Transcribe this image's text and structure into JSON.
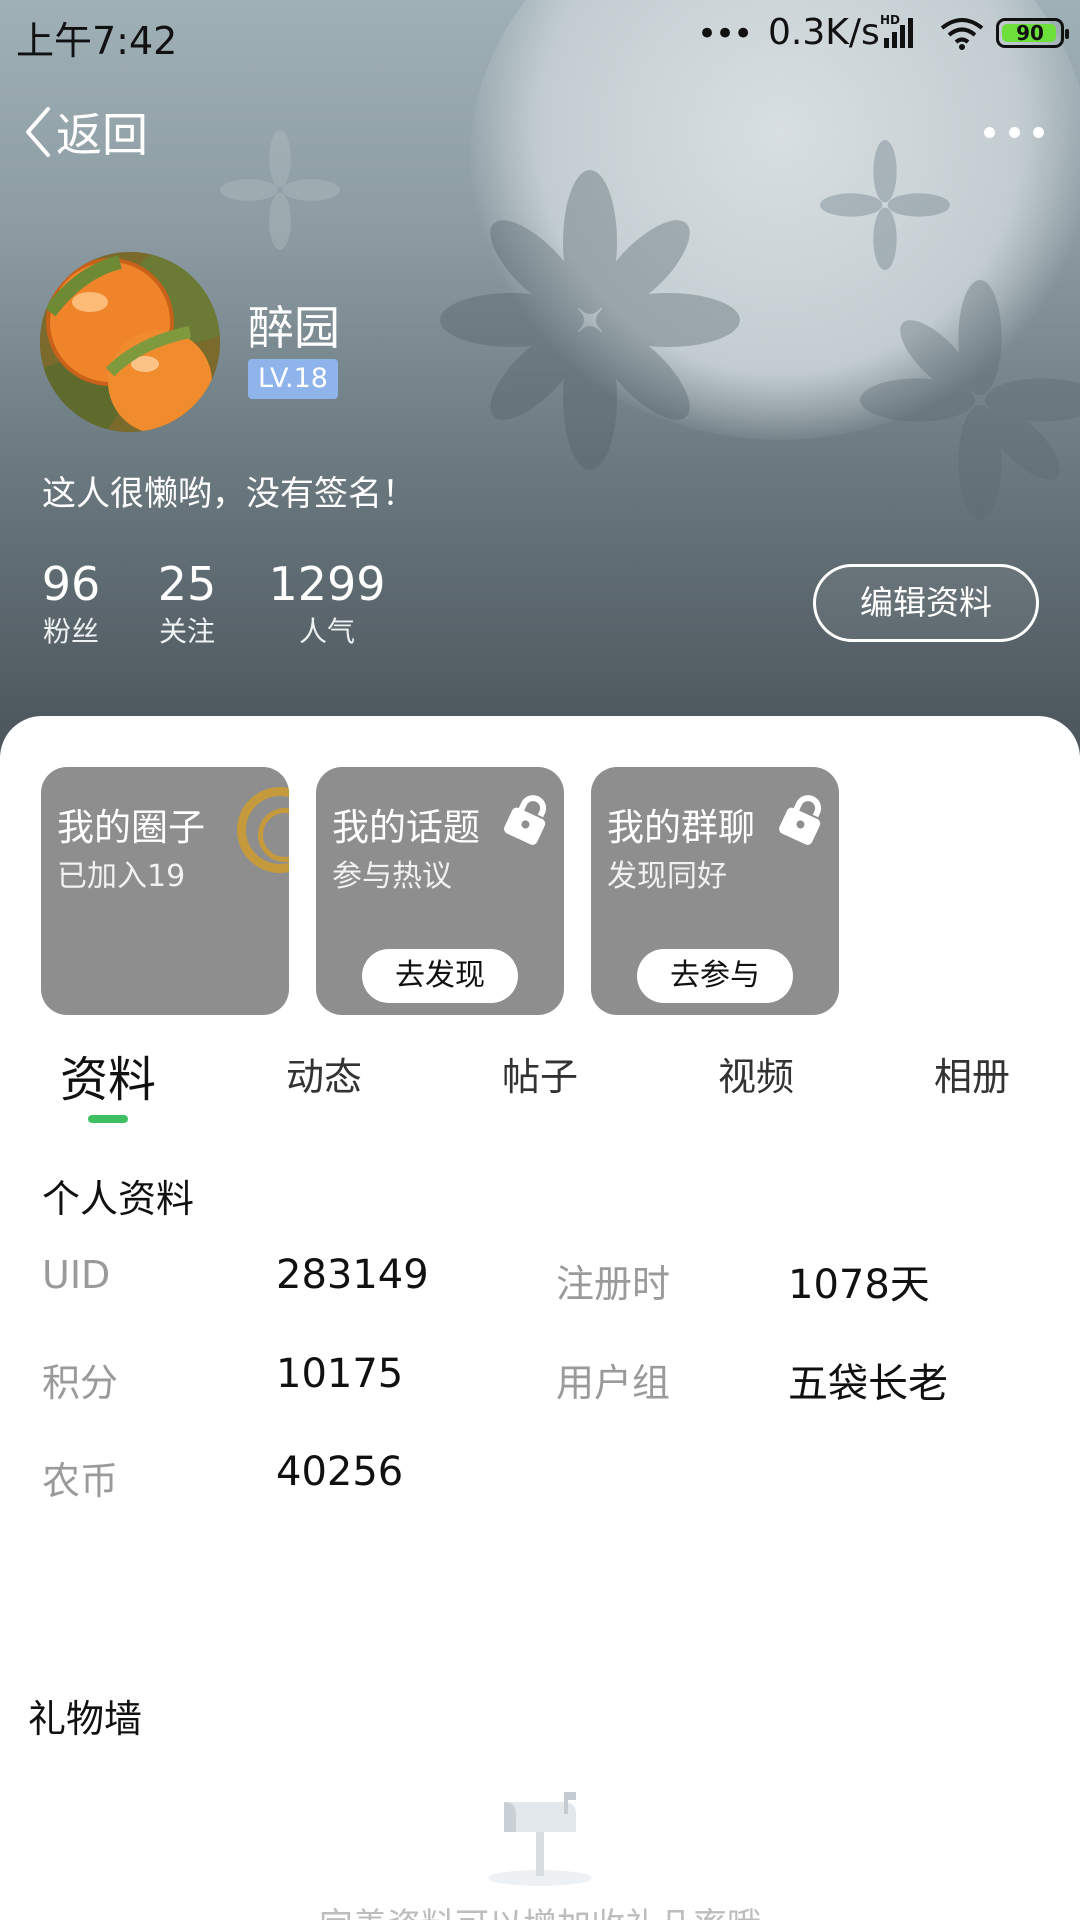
{
  "status_bar": {
    "time": "上午7:42",
    "dots": "•••",
    "network_speed": "0.3K/s",
    "battery": "90"
  },
  "header": {
    "back_label": "返回",
    "more_icon": "more-horizontal-icon"
  },
  "profile": {
    "username": "醉园",
    "level": "LV.18",
    "signature": "这人很懒哟，没有签名！",
    "edit_button": "编辑资料",
    "stats": [
      {
        "value": "96",
        "label": "粉丝"
      },
      {
        "value": "25",
        "label": "关注"
      },
      {
        "value": "1299",
        "label": "人气"
      }
    ]
  },
  "cards": [
    {
      "title": "我的圈子",
      "subtitle": "已加入19",
      "button": ""
    },
    {
      "title": "我的话题",
      "subtitle": "参与热议",
      "button": "去发现"
    },
    {
      "title": "我的群聊",
      "subtitle": "发现同好",
      "button": "去参与"
    }
  ],
  "tabs": [
    {
      "label": "资料",
      "active": true
    },
    {
      "label": "动态",
      "active": false
    },
    {
      "label": "帖子",
      "active": false
    },
    {
      "label": "视频",
      "active": false
    },
    {
      "label": "相册",
      "active": false
    }
  ],
  "personal_info": {
    "title": "个人资料",
    "fields": [
      {
        "label": "UID",
        "value": "283149"
      },
      {
        "label": "注册时",
        "value": "1078天"
      },
      {
        "label": "积分",
        "value": "10175"
      },
      {
        "label": "用户组",
        "value": "五袋长老"
      },
      {
        "label": "农币",
        "value": "40256"
      }
    ]
  },
  "gift_wall": {
    "title": "礼物墙",
    "empty_text": "完善资料可以增加收礼几率哦"
  },
  "colors": {
    "accent": "#3fbf62",
    "level_badge": "#8fb4ec",
    "card_bg": "#8e8e8e"
  }
}
